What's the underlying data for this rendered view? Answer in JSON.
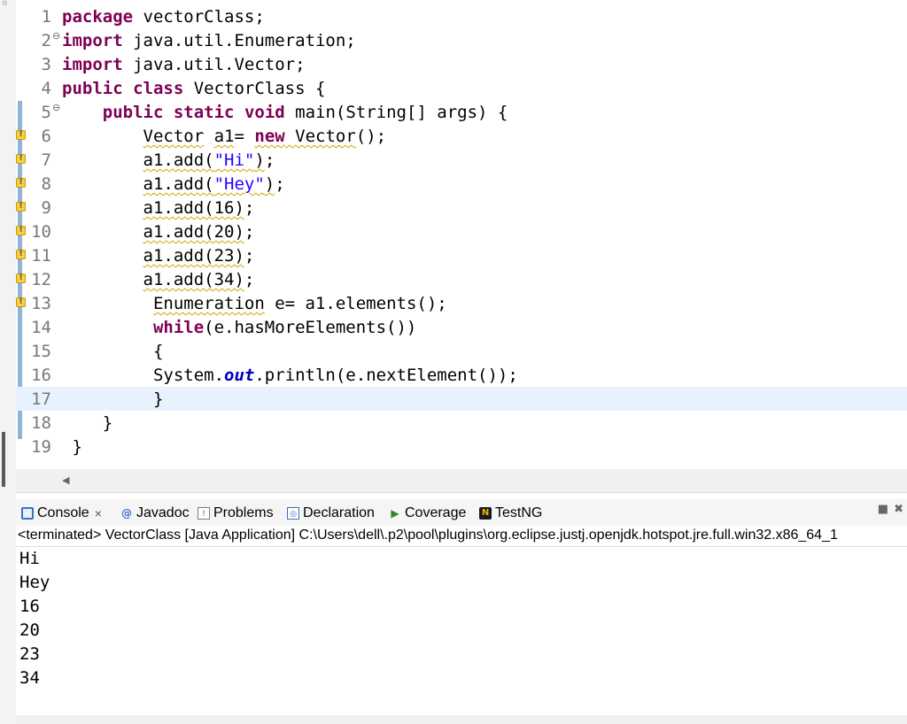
{
  "editor": {
    "lines": [
      {
        "num": "1",
        "fold": "",
        "marker": false,
        "segs": [
          {
            "t": "package",
            "c": "kw"
          },
          {
            "t": " vectorClass;"
          }
        ]
      },
      {
        "num": "2",
        "fold": "⊖",
        "marker": false,
        "segs": [
          {
            "t": "import",
            "c": "kw"
          },
          {
            "t": " java.util.Enumeration;"
          }
        ]
      },
      {
        "num": "3",
        "fold": "",
        "marker": false,
        "segs": [
          {
            "t": "import",
            "c": "kw"
          },
          {
            "t": " java.util.Vector;"
          }
        ]
      },
      {
        "num": "4",
        "fold": "",
        "marker": false,
        "segs": [
          {
            "t": "public",
            "c": "kw"
          },
          {
            "t": " "
          },
          {
            "t": "class",
            "c": "kw"
          },
          {
            "t": " VectorClass {"
          }
        ]
      },
      {
        "num": "5",
        "fold": "⊖",
        "marker": false,
        "segs": [
          {
            "t": "    "
          },
          {
            "t": "public",
            "c": "kw"
          },
          {
            "t": " "
          },
          {
            "t": "static",
            "c": "kw"
          },
          {
            "t": " "
          },
          {
            "t": "void",
            "c": "kw"
          },
          {
            "t": " main(String[] args) {"
          }
        ]
      },
      {
        "num": "6",
        "fold": "",
        "marker": true,
        "segs": [
          {
            "t": "        "
          },
          {
            "t": "Vector",
            "c": "wv"
          },
          {
            "t": " "
          },
          {
            "t": "a1",
            "c": "wv"
          },
          {
            "t": "= "
          },
          {
            "t": "new",
            "c": "kw wv"
          },
          {
            "t": " Vector",
            "c": "wv"
          },
          {
            "t": "();"
          }
        ]
      },
      {
        "num": "7",
        "fold": "",
        "marker": true,
        "segs": [
          {
            "t": "        "
          },
          {
            "t": "a1.add(",
            "c": "wv"
          },
          {
            "t": "\"Hi\"",
            "c": "str wv"
          },
          {
            "t": ")",
            "c": "wv"
          },
          {
            "t": ";"
          }
        ]
      },
      {
        "num": "8",
        "fold": "",
        "marker": true,
        "segs": [
          {
            "t": "        "
          },
          {
            "t": "a1.add(",
            "c": "wv"
          },
          {
            "t": "\"Hey\"",
            "c": "str wv"
          },
          {
            "t": ")",
            "c": "wv"
          },
          {
            "t": ";"
          }
        ]
      },
      {
        "num": "9",
        "fold": "",
        "marker": true,
        "segs": [
          {
            "t": "        "
          },
          {
            "t": "a1.add(16)",
            "c": "wv"
          },
          {
            "t": ";"
          }
        ]
      },
      {
        "num": "10",
        "fold": "",
        "marker": true,
        "segs": [
          {
            "t": "        "
          },
          {
            "t": "a1.add(20)",
            "c": "wv"
          },
          {
            "t": ";"
          }
        ]
      },
      {
        "num": "11",
        "fold": "",
        "marker": true,
        "segs": [
          {
            "t": "        "
          },
          {
            "t": "a1.add(23)",
            "c": "wv"
          },
          {
            "t": ";"
          }
        ]
      },
      {
        "num": "12",
        "fold": "",
        "marker": true,
        "segs": [
          {
            "t": "        "
          },
          {
            "t": "a1.add(34)",
            "c": "wv"
          },
          {
            "t": ";"
          }
        ]
      },
      {
        "num": "13",
        "fold": "",
        "marker": true,
        "segs": [
          {
            "t": "         "
          },
          {
            "t": "Enumeration",
            "c": "wv"
          },
          {
            "t": " e= a1.elements();"
          }
        ]
      },
      {
        "num": "14",
        "fold": "",
        "marker": false,
        "segs": [
          {
            "t": "         "
          },
          {
            "t": "while",
            "c": "kw"
          },
          {
            "t": "(e.hasMoreElements())"
          }
        ]
      },
      {
        "num": "15",
        "fold": "",
        "marker": false,
        "segs": [
          {
            "t": "         {"
          }
        ]
      },
      {
        "num": "16",
        "fold": "",
        "marker": false,
        "segs": [
          {
            "t": "         System."
          },
          {
            "t": "out",
            "c": "fld"
          },
          {
            "t": ".println(e.nextElement());"
          }
        ]
      },
      {
        "num": "17",
        "fold": "",
        "marker": false,
        "current": true,
        "segs": [
          {
            "t": "         }"
          }
        ]
      },
      {
        "num": "18",
        "fold": "",
        "marker": false,
        "segs": [
          {
            "t": "    }"
          }
        ]
      },
      {
        "num": "19",
        "fold": "",
        "marker": false,
        "segs": [
          {
            "t": " }"
          }
        ]
      }
    ]
  },
  "console": {
    "tabs": [
      {
        "label": "Console",
        "icon": "console-icon",
        "closable": true
      },
      {
        "label": "Javadoc",
        "icon": "javadoc-icon"
      },
      {
        "label": "Problems",
        "icon": "problems-icon"
      },
      {
        "label": "Declaration",
        "icon": "declaration-icon"
      },
      {
        "label": "Coverage",
        "icon": "coverage-icon"
      },
      {
        "label": "TestNG",
        "icon": "testng-icon"
      }
    ],
    "close_glyph": "×",
    "status": "<terminated> VectorClass [Java Application] C:\\Users\\dell\\.p2\\pool\\plugins\\org.eclipse.justj.openjdk.hotspot.jre.full.win32.x86_64_1",
    "output": [
      "Hi",
      "Hey",
      "16",
      "20",
      "23",
      "34"
    ]
  },
  "icons": {
    "console": "console-icon",
    "javadoc": "javadoc-icon",
    "problems": "problems-icon",
    "declaration": "declaration-icon",
    "coverage": "coverage-icon",
    "testng": "testng-icon",
    "warning_marker": "warning-marker-icon",
    "fold": "fold-collapse-icon",
    "scroll_left": "scroll-left-arrow-icon"
  },
  "colors": {
    "keyword": "#7f0055",
    "string": "#2a00ff",
    "static_field": "#0000c0",
    "current_line": "#e8f2fe",
    "warning_underline": "#d5a200",
    "annotation_bar": "#8fb3d9"
  }
}
